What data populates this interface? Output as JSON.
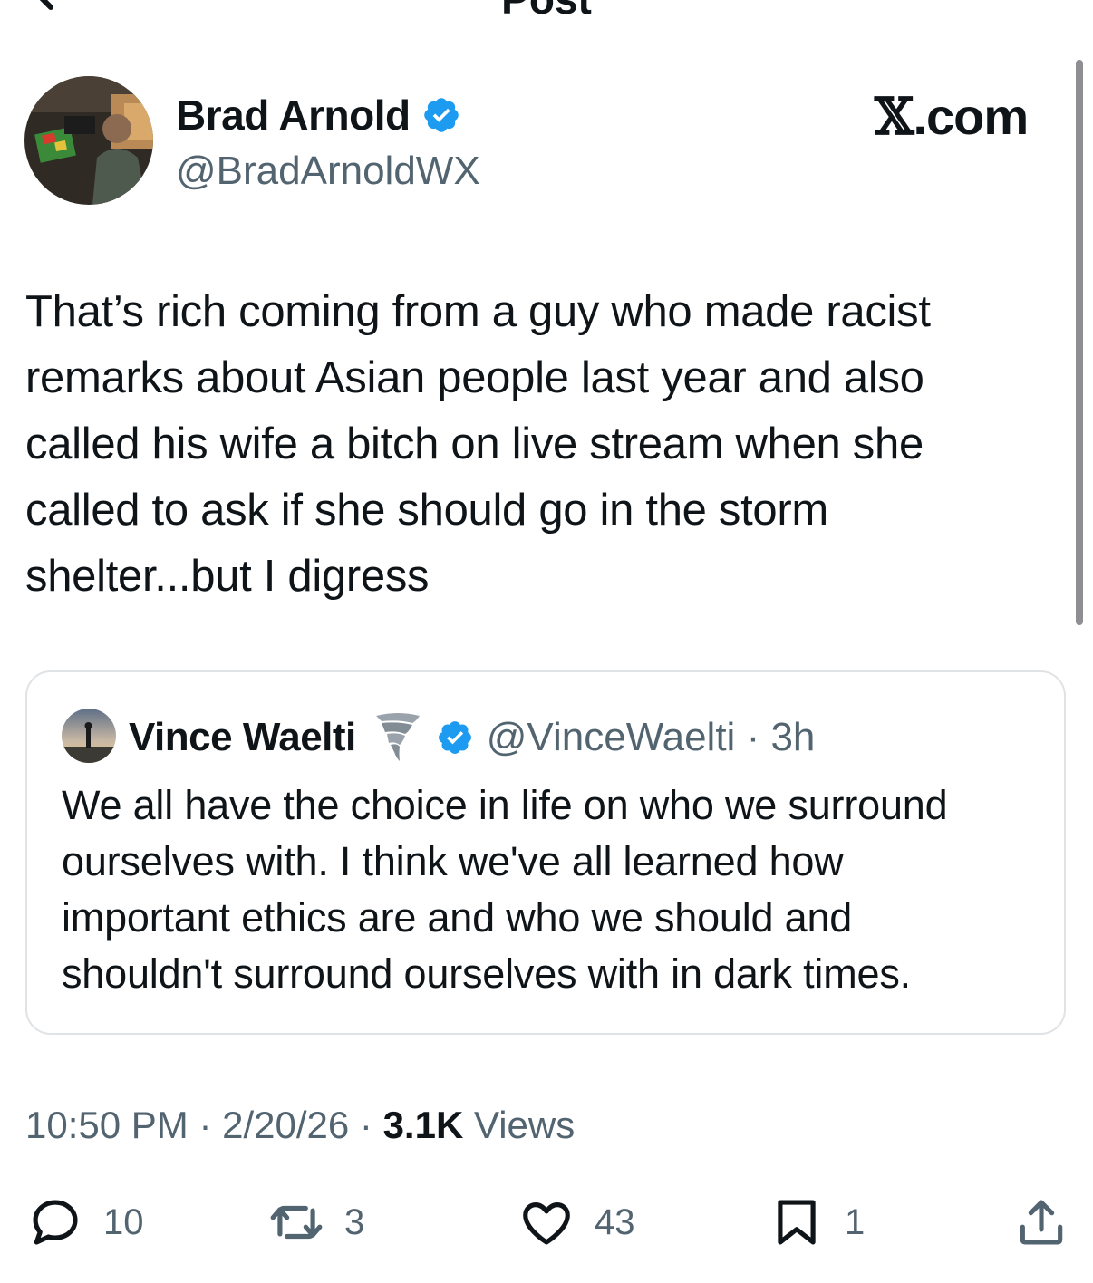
{
  "nav": {
    "title": "Post"
  },
  "author": {
    "display_name": "Brad Arnold",
    "handle": "@BradArnoldWX",
    "verified": true
  },
  "watermark": {
    "x": "𝕏",
    "suffix": ".com"
  },
  "post": {
    "text_lines": [
      "That’s rich coming from a guy who made racist",
      "remarks about Asian people last year and also",
      "called his wife a bitch on live stream when she",
      "called to ask if she should go in the storm",
      "shelter...but I digress"
    ]
  },
  "quote": {
    "display_name": "Vince Waelti",
    "handle": "@VinceWaelti",
    "separator": "·",
    "time": "3h",
    "verified": true,
    "name_emoji": "tornado-icon",
    "text_lines": [
      "We all have the choice in life on who we surround",
      "ourselves with. I think we've all learned how",
      "important ethics are and who we should and",
      "shouldn't surround ourselves with in dark times."
    ]
  },
  "meta": {
    "time": "10:50 PM",
    "sep1": " · ",
    "date": "2/20/26",
    "sep2": " · ",
    "views_count": "3.1K",
    "views_label": " Views"
  },
  "actions": {
    "replies": "10",
    "reposts": "3",
    "likes": "43",
    "bookmarks": "1"
  },
  "colors": {
    "text": "#0f1419",
    "secondary": "#536471",
    "verified": "#1d9bf0",
    "border": "#dfe3e6"
  }
}
